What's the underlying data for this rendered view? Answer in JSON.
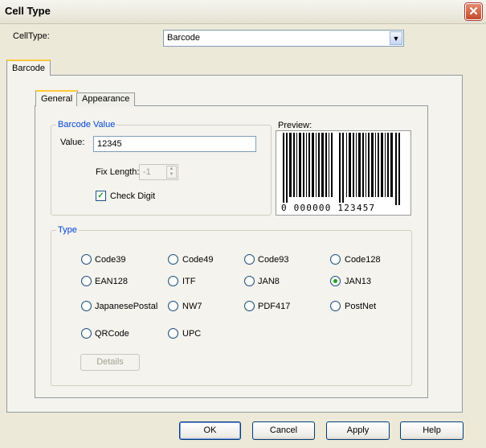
{
  "window": {
    "title": "Cell Type"
  },
  "celltype": {
    "label": "CellType:",
    "value": "Barcode"
  },
  "outer_tab": {
    "label": "Barcode"
  },
  "inner_tabs": [
    {
      "label": "General"
    },
    {
      "label": "Appearance"
    }
  ],
  "barcode_value": {
    "legend": "Barcode Value",
    "value_label": "Value:",
    "value": "12345",
    "fix_length_label": "Fix Length:",
    "fix_length_value": "-1",
    "check_digit_label": "Check Digit",
    "check_digit_checked": true
  },
  "preview": {
    "label": "Preview:",
    "digits": "0 000000 123457"
  },
  "type": {
    "legend": "Type",
    "options": [
      "Code39",
      "Code49",
      "Code93",
      "Code128",
      "EAN128",
      "ITF",
      "JAN8",
      "JAN13",
      "JapanesePostal",
      "NW7",
      "PDF417",
      "PostNet",
      "QRCode",
      "UPC"
    ],
    "selected": "JAN13",
    "details_label": "Details"
  },
  "buttons": {
    "ok": "OK",
    "cancel": "Cancel",
    "apply": "Apply",
    "help": "Help"
  },
  "icons": {
    "close": "close-icon",
    "dropdown": "chevron-down-icon"
  }
}
